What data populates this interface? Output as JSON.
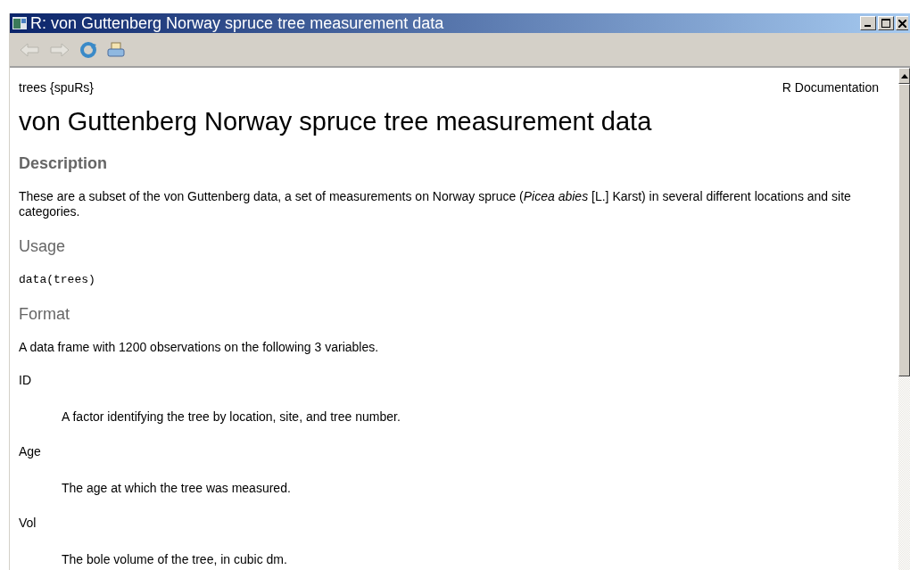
{
  "window": {
    "title": "R: von Guttenberg Norway spruce tree measurement data"
  },
  "toolbar": [
    {
      "kind": "back",
      "disabled": true
    },
    {
      "kind": "forward",
      "disabled": true
    },
    {
      "kind": "refresh",
      "disabled": false
    },
    {
      "kind": "print",
      "disabled": false
    }
  ],
  "doc": {
    "topic": "trees {spuRs}",
    "source": "R Documentation",
    "title": "von Guttenberg Norway spruce tree measurement data",
    "sections": [
      {
        "heading": "Description",
        "kind": "text",
        "text": "These are a subset of the von Guttenberg data, a set of measurements on Norway spruce (*Picea abies* [L.] Karst) in several different locations and site categories."
      },
      {
        "heading": "Usage",
        "kind": "code",
        "text": "data(trees)"
      },
      {
        "heading": "Format",
        "kind": "vars",
        "text": "A data frame with 1200 observations on the following 3 variables.",
        "items": [
          {
            "term": "ID",
            "definition": "A factor identifying the tree by location, site, and tree number."
          },
          {
            "term": "Age",
            "definition": "The age at which the tree was measured."
          },
          {
            "term": "Vol",
            "definition": "The bole volume of the tree, in cubic dm."
          }
        ]
      }
    ]
  }
}
